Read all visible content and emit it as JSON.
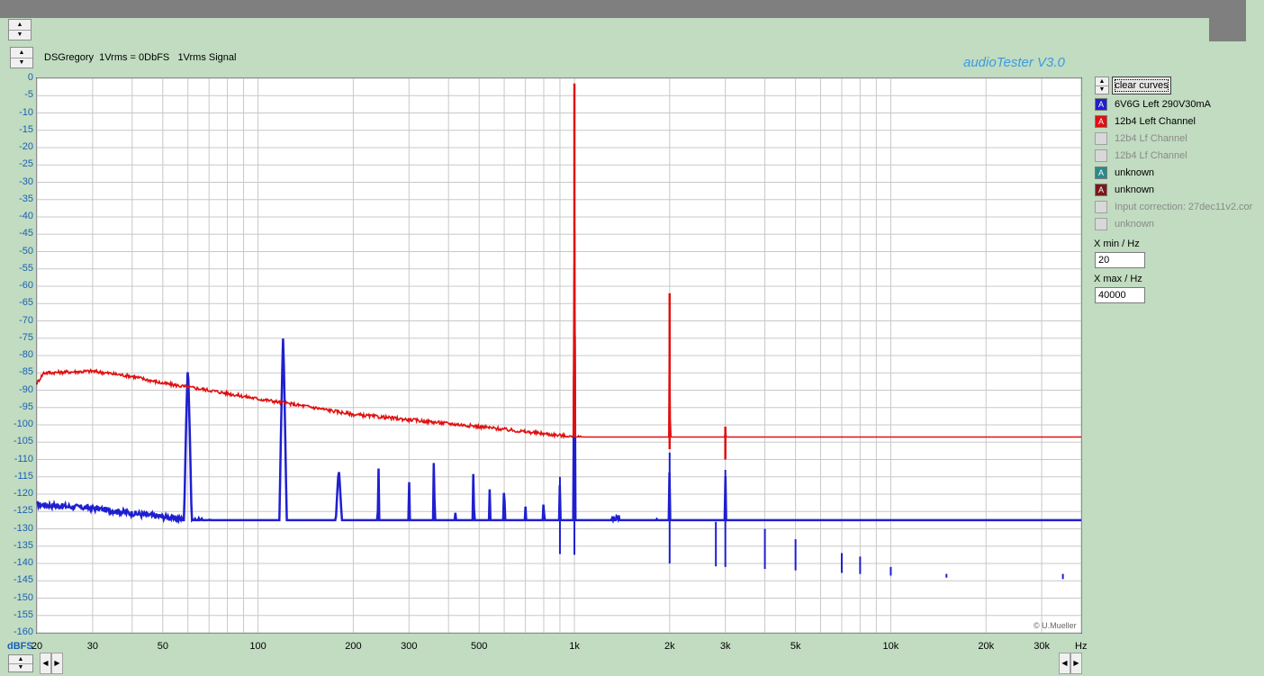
{
  "header": {
    "title_text": "DSGregory  1Vrms = 0DbFS   1Vrms Signal",
    "brand": "audioTester  V3.0"
  },
  "controls": {
    "clear_curves": "clear curves",
    "xmin_label": "X min / Hz",
    "xmin_value": "20",
    "xmax_label": "X max / Hz",
    "xmax_value": "40000"
  },
  "legend": [
    {
      "label": "6V6G Left 290V30mA",
      "color": "#1f1fd0",
      "glyph": "A",
      "enabled": true
    },
    {
      "label": "12b4 Left Channel",
      "color": "#e01010",
      "glyph": "A",
      "enabled": true
    },
    {
      "label": "12b4 Lf Channel",
      "color": "",
      "glyph": "",
      "enabled": false
    },
    {
      "label": "12b4 Lf Channel",
      "color": "",
      "glyph": "",
      "enabled": false
    },
    {
      "label": "unknown",
      "color": "#2a8a8a",
      "glyph": "A",
      "enabled": true
    },
    {
      "label": "unknown",
      "color": "#7a1a1a",
      "glyph": "A",
      "enabled": true
    },
    {
      "label": "Input correction: 27dec11v2.cor",
      "color": "",
      "glyph": "",
      "enabled": false
    },
    {
      "label": "unknown",
      "color": "",
      "glyph": "",
      "enabled": false
    }
  ],
  "footer": {
    "copyright": "© U.Mueller",
    "y_unit": "dBFS",
    "x_unit": "Hz"
  },
  "chart_data": {
    "type": "line",
    "xscale": "log",
    "xlim": [
      20,
      40000
    ],
    "ylim": [
      -160,
      0
    ],
    "grid": true,
    "y_ticks": [
      0,
      -5,
      -10,
      -15,
      -20,
      -25,
      -30,
      -35,
      -40,
      -45,
      -50,
      -55,
      -60,
      -65,
      -70,
      -75,
      -80,
      -85,
      -90,
      -95,
      -100,
      -105,
      -110,
      -115,
      -120,
      -125,
      -130,
      -135,
      -140,
      -145,
      -150,
      -155,
      -160
    ],
    "x_ticks": [
      {
        "value": 20,
        "label": "20"
      },
      {
        "value": 30,
        "label": "30"
      },
      {
        "value": 50,
        "label": "50"
      },
      {
        "value": 100,
        "label": "100"
      },
      {
        "value": 200,
        "label": "200"
      },
      {
        "value": 300,
        "label": "300"
      },
      {
        "value": 500,
        "label": "500"
      },
      {
        "value": 1000,
        "label": "1k"
      },
      {
        "value": 2000,
        "label": "2k"
      },
      {
        "value": 3000,
        "label": "3k"
      },
      {
        "value": 5000,
        "label": "5k"
      },
      {
        "value": 10000,
        "label": "10k"
      },
      {
        "value": 20000,
        "label": "20k"
      },
      {
        "value": 30000,
        "label": "30k"
      }
    ],
    "series": [
      {
        "name": "12b4 Left Channel",
        "color": "#e01010",
        "floor": [
          [
            20,
            -88
          ],
          [
            21,
            -85
          ],
          [
            30,
            -84.5
          ],
          [
            40,
            -86
          ],
          [
            50,
            -88
          ],
          [
            70,
            -90
          ],
          [
            100,
            -92.5
          ],
          [
            150,
            -95
          ],
          [
            200,
            -97
          ],
          [
            300,
            -98.5
          ],
          [
            500,
            -100.5
          ],
          [
            700,
            -102
          ],
          [
            1000,
            -103.5
          ],
          [
            2000,
            -107
          ],
          [
            3000,
            -110
          ],
          [
            5000,
            -112.5
          ],
          [
            10000,
            -116
          ],
          [
            20000,
            -120
          ],
          [
            40000,
            -126
          ]
        ],
        "peaks": [
          [
            1000,
            -1.5
          ],
          [
            2000,
            -62
          ],
          [
            3000,
            -100.5
          ]
        ]
      },
      {
        "name": "6V6G Left 290V30mA",
        "color": "#1f1fd0",
        "floor": [
          [
            20,
            -123
          ],
          [
            30,
            -124
          ],
          [
            40,
            -125.5
          ],
          [
            50,
            -126.5
          ],
          [
            60,
            -127.5
          ],
          [
            70,
            -128
          ],
          [
            100,
            -129.5
          ],
          [
            150,
            -131.5
          ],
          [
            200,
            -133
          ],
          [
            300,
            -134.5
          ],
          [
            500,
            -136
          ],
          [
            1000,
            -137.5
          ],
          [
            2000,
            -140
          ],
          [
            3000,
            -141
          ],
          [
            5000,
            -142
          ],
          [
            10000,
            -143.5
          ],
          [
            20000,
            -144.5
          ],
          [
            40000,
            -144.5
          ]
        ],
        "peaks": [
          [
            60,
            -83
          ],
          [
            120,
            -75
          ],
          [
            180,
            -113
          ],
          [
            240,
            -105
          ],
          [
            300,
            -113
          ],
          [
            360,
            -99
          ],
          [
            420,
            -123
          ],
          [
            480,
            -104
          ],
          [
            540,
            -118
          ],
          [
            600,
            -107
          ],
          [
            700,
            -122
          ],
          [
            800,
            -113
          ],
          [
            900,
            -115
          ],
          [
            1000,
            -29
          ],
          [
            2000,
            -108
          ],
          [
            2800,
            -128
          ],
          [
            3000,
            -113
          ],
          [
            4000,
            -130
          ],
          [
            5000,
            -133
          ],
          [
            7000,
            -137
          ],
          [
            8000,
            -138
          ],
          [
            10000,
            -141
          ],
          [
            15000,
            -143
          ],
          [
            35000,
            -143
          ]
        ],
        "hump": [
          [
            1050,
            -134
          ],
          [
            1150,
            -131
          ],
          [
            1250,
            -132
          ],
          [
            1350,
            -129
          ],
          [
            1500,
            -131
          ],
          [
            1600,
            -130
          ],
          [
            1750,
            -133
          ],
          [
            1900,
            -130
          ]
        ]
      }
    ]
  }
}
